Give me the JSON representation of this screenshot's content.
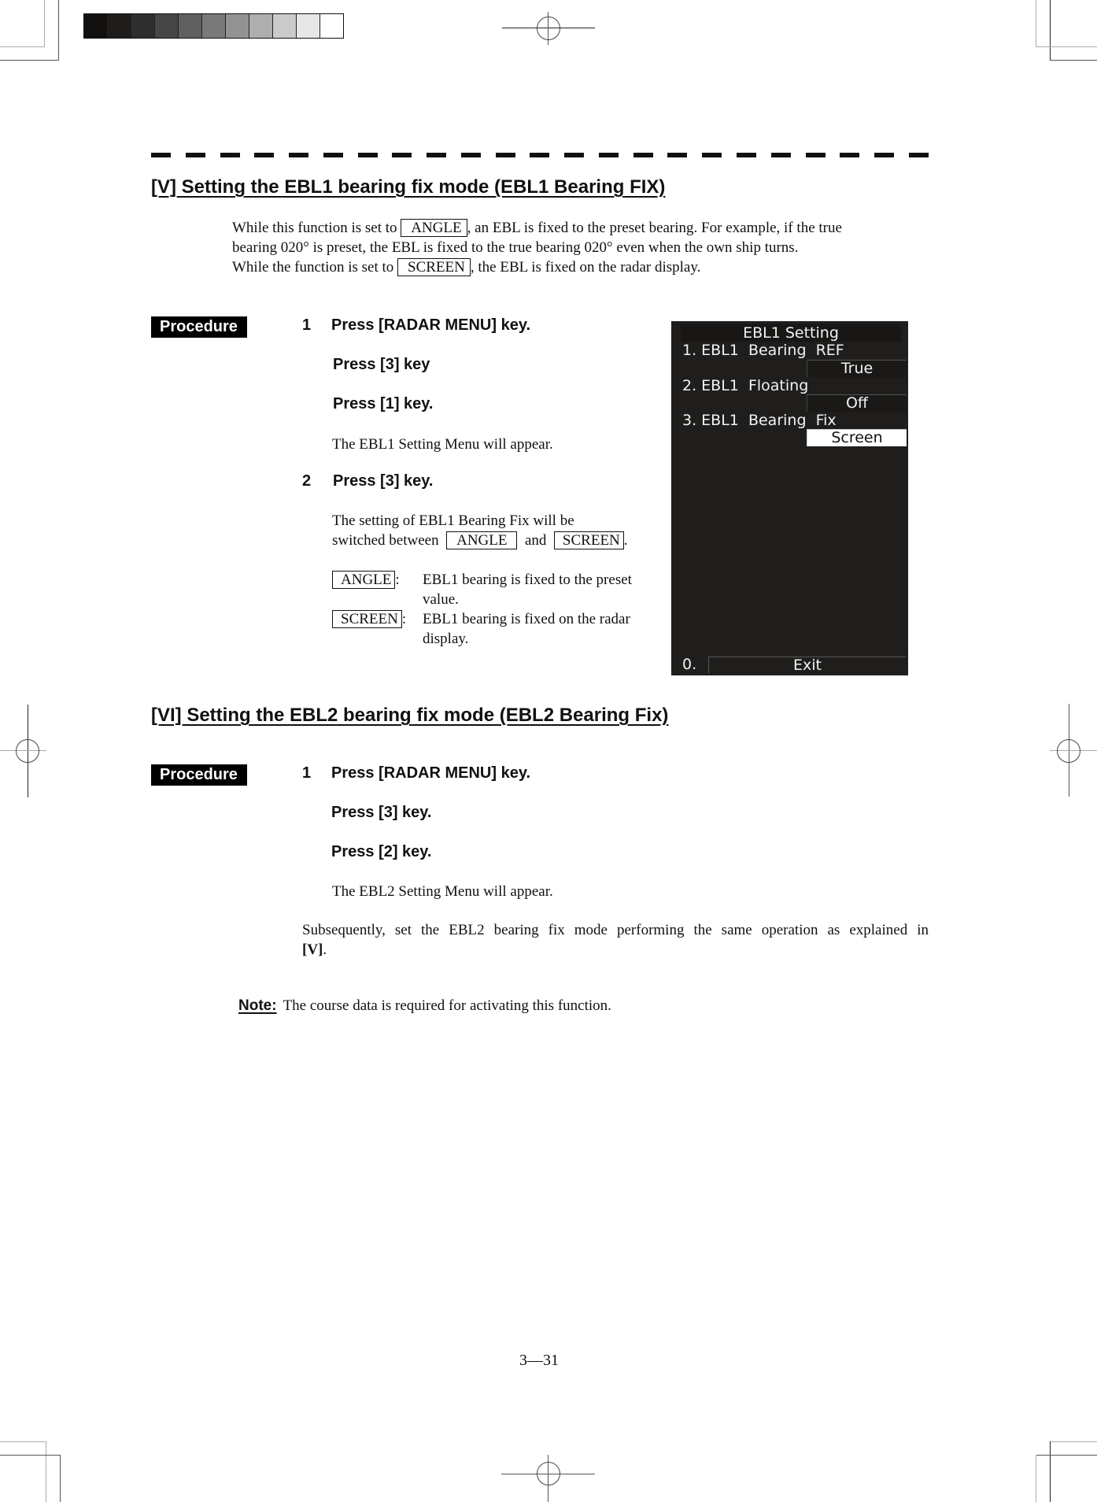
{
  "print_marks": {
    "gray_scale": [
      "#121110",
      "#1e1d1c",
      "#2e2e2e",
      "#464646",
      "#5f6060",
      "#797979",
      "#939393",
      "#aeaeae",
      "#cbcbcb",
      "#e7e7e7",
      "#ffffff"
    ]
  },
  "section_v": {
    "title": "[V] Setting the EBL1 bearing fix mode (EBL1 Bearing FIX)",
    "intro": {
      "line1_pre": "While this function is set to ",
      "line1_key": "ANGLE",
      "line1_post": ", an EBL is fixed to the preset bearing.   For example, if the true",
      "line2": "bearing 020° is preset, the EBL is fixed to the true bearing 020° even when the own ship turns.",
      "line3_pre": "While the function is set to ",
      "line3_key": "SCREEN",
      "line3_post": ", the EBL is fixed on the radar display."
    },
    "procedure_label": "Procedure",
    "steps": [
      {
        "number": "1",
        "lines": [
          "Press [RADAR MENU] key.",
          "Press [3] key",
          "Press [1] key."
        ],
        "note": "The EBL1 Setting Menu will appear."
      },
      {
        "number": "2",
        "lines": [
          "Press [3] key."
        ],
        "note_line1": "The setting of EBL1 Bearing Fix will be",
        "note_line2_pre": "switched between",
        "key_a": "ANGLE",
        "and": "and",
        "key_b": "SCREEN",
        "period": "."
      }
    ],
    "definitions": [
      {
        "key": "ANGLE",
        "sep": ":",
        "line1": "EBL1 bearing is fixed to the preset",
        "line2": "value."
      },
      {
        "key": "SCREEN",
        "sep": ":",
        "line1": "EBL1 bearing is fixed on the radar",
        "line2": "display."
      }
    ]
  },
  "radar_menu": {
    "title": "EBL1  Setting",
    "items": [
      {
        "label": "1. EBL1  Bearing  REF",
        "value": "True",
        "selected": false
      },
      {
        "label": "2. EBL1  Floating",
        "value": "Off",
        "selected": false
      },
      {
        "label": "3. EBL1  Bearing  Fix",
        "value": "Screen",
        "selected": true
      }
    ],
    "exit_number": "0.",
    "exit_label": "Exit"
  },
  "section_vi": {
    "title": "[VI] Setting the EBL2 bearing fix mode (EBL2 Bearing Fix)",
    "procedure_label": "Procedure",
    "step_number": "1",
    "lines": [
      "Press [RADAR MENU] key.",
      "Press [3] key.",
      "Press [2] key."
    ],
    "note": "The EBL2 Setting Menu will appear.",
    "subsequently_pre": "Subsequently, set the EBL2 bearing fix mode performing the same operation as explained in",
    "subsequently_ref": "[V]",
    "subsequently_post": "."
  },
  "note": {
    "label": "Note:",
    "text": "The course data is required for activating this function."
  },
  "footer": {
    "page_number": "3—31"
  }
}
